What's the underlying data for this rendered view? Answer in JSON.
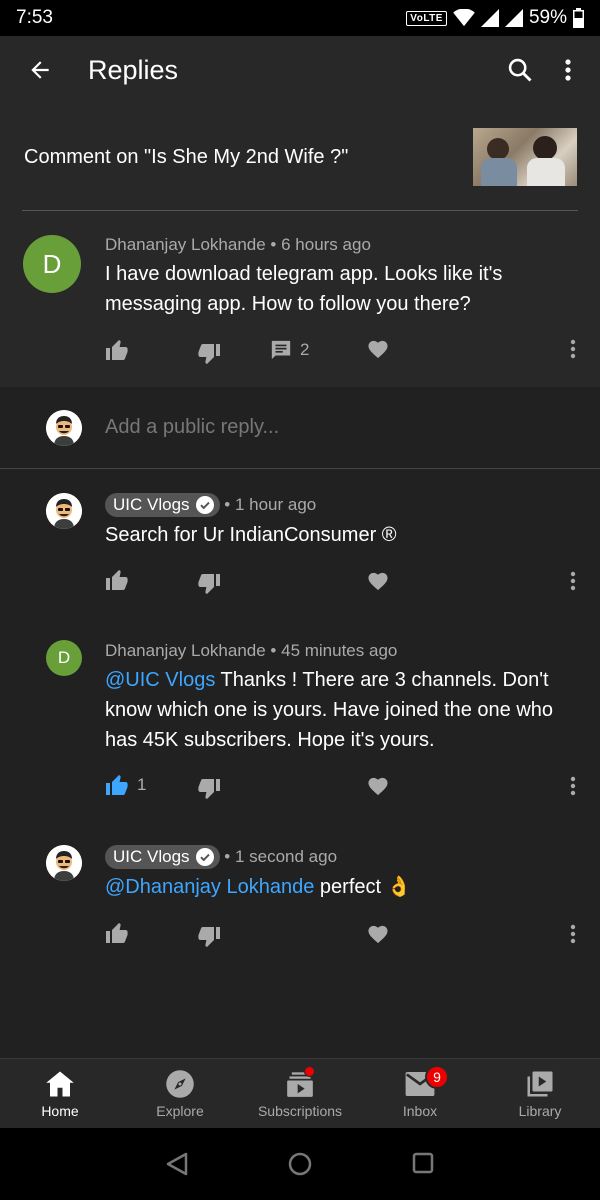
{
  "status": {
    "time": "7:53",
    "network": "VoLTE",
    "battery": "59%"
  },
  "appbar": {
    "title": "Replies",
    "back_icon": "back-arrow-icon",
    "search_icon": "search-icon",
    "more_icon": "more-vert-icon"
  },
  "video": {
    "comment_on": "Comment on \"Is She My 2nd Wife ?\""
  },
  "comment": {
    "avatar_letter": "D",
    "author": "Dhananjay Lokhande",
    "time": "6 hours ago",
    "text": "I have download telegram app. Looks like it's messaging app. How to follow you there?",
    "reply_count": "2"
  },
  "reply_box": {
    "placeholder": "Add a public reply..."
  },
  "replies": [
    {
      "author": "UIC Vlogs",
      "time": "1 hour ago",
      "text": "Search for Ur IndianConsumer ®"
    },
    {
      "avatar_letter": "D",
      "author": "Dhananjay Lokhande",
      "time": "45 minutes ago",
      "mention": "@UIC Vlogs",
      "text": " Thanks ! There are 3 channels. Don't know which one is yours. Have joined the one who has 45K subscribers. Hope it's yours.",
      "likes": "1"
    },
    {
      "author": "UIC Vlogs",
      "time": "1 second ago",
      "mention": "@Dhananjay Lokhande",
      "text": " perfect 👌"
    }
  ],
  "bottom_nav": {
    "items": [
      {
        "label": "Home",
        "icon": "home-icon"
      },
      {
        "label": "Explore",
        "icon": "compass-icon"
      },
      {
        "label": "Subscriptions",
        "icon": "subscriptions-icon"
      },
      {
        "label": "Inbox",
        "icon": "mail-icon",
        "badge": "9"
      },
      {
        "label": "Library",
        "icon": "library-icon"
      }
    ]
  },
  "colors": {
    "background": "#212121",
    "surface": "#282828",
    "link": "#3ea6ff",
    "avatar_green": "#689f38",
    "badge_red": "#e00000"
  }
}
